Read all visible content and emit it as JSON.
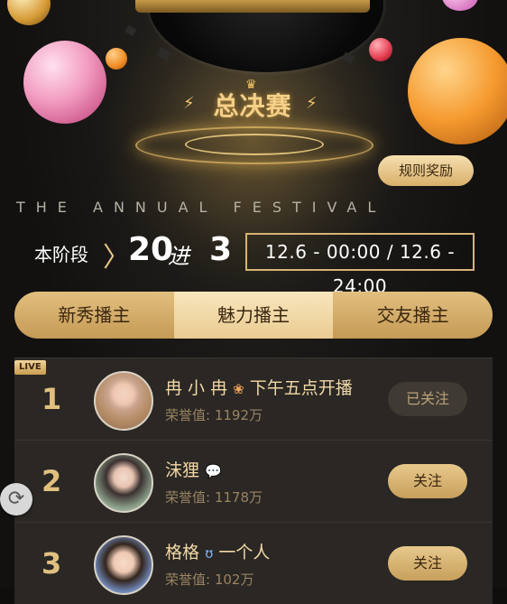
{
  "hero": {
    "title": "总决赛",
    "subtitle": "THE ANNUAL FESTIVAL"
  },
  "rules_button": "规则奖励",
  "stage": {
    "label": "本阶段",
    "from": "20",
    "connector": "进",
    "to": "3",
    "time_range": "12.6 - 00:00 / 12.6 - 24:00"
  },
  "tabs": [
    {
      "label": "新秀播主",
      "active": false
    },
    {
      "label": "魅力播主",
      "active": true
    },
    {
      "label": "交友播主",
      "active": false
    }
  ],
  "rankings": [
    {
      "rank": "1",
      "live": "LIVE",
      "name": "冉 小 冉",
      "name_suffix": "下午五点开播",
      "score": "荣誉值: 1192万",
      "button": "已关注",
      "followed": true
    },
    {
      "rank": "2",
      "name": "沫狸",
      "name_suffix": "",
      "score": "荣誉值: 1178万",
      "button": "关注",
      "followed": false
    },
    {
      "rank": "3",
      "name": "格格",
      "name_suffix": "一个人",
      "score": "荣誉值: 102万",
      "button": "关注",
      "followed": false
    }
  ],
  "icons": {
    "refresh": "refresh-icon",
    "flower": "flower-icon",
    "bubble": "speech-bubble-icon",
    "wink": "wink-icon"
  },
  "colors": {
    "accent": "#d9b36e",
    "background": "#0f0e0c"
  }
}
